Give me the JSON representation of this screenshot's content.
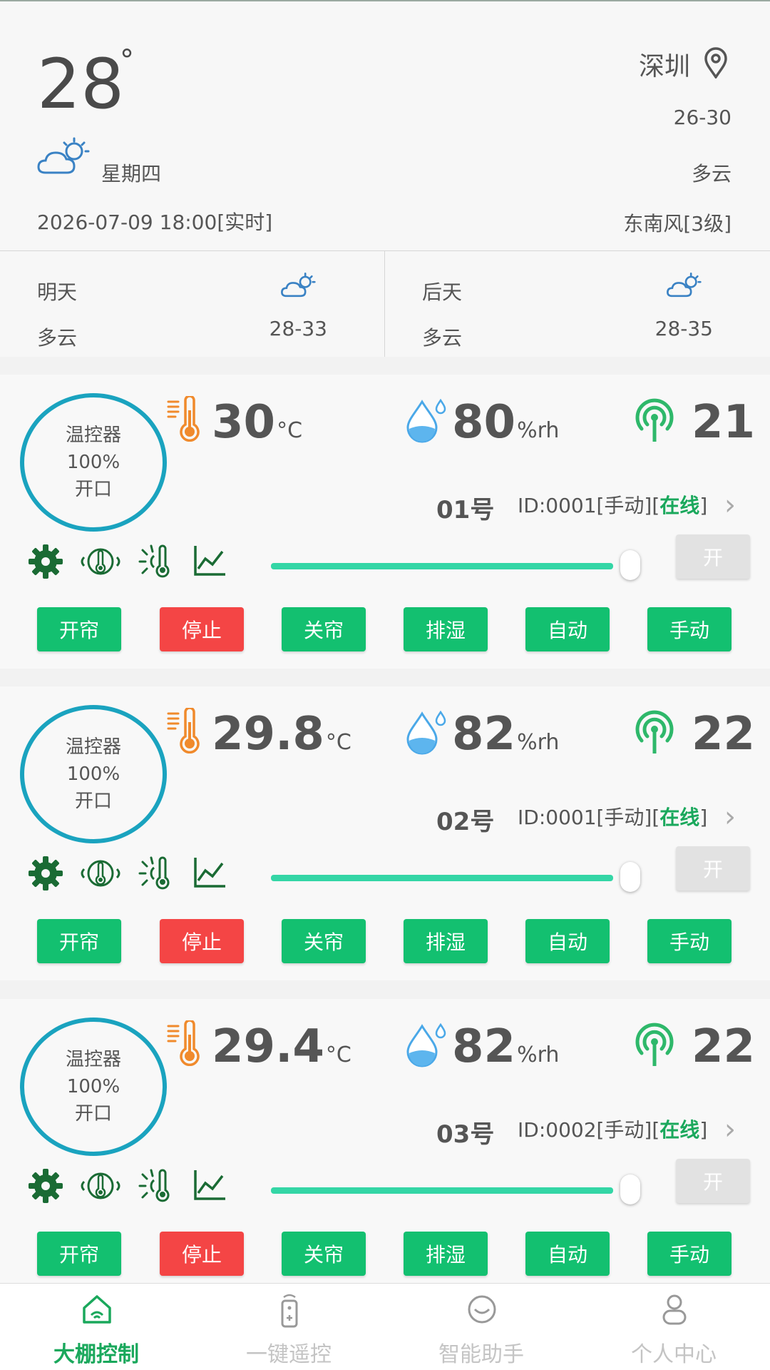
{
  "weather": {
    "temp": "28",
    "deg": "°",
    "weekday": "星期四",
    "datetime": "2026-07-09 18:00[实时]",
    "city": "深圳",
    "temp_range": "26-30",
    "condition": "多云",
    "wind": "东南风[3级]"
  },
  "forecast": [
    {
      "day": "明天",
      "condition": "多云",
      "range": "28-33"
    },
    {
      "day": "后天",
      "condition": "多云",
      "range": "28-35"
    }
  ],
  "devices": [
    {
      "ring": [
        "温控器",
        "100%",
        "开口"
      ],
      "temp": "30",
      "temp_unit": "°C",
      "hum": "80",
      "hum_unit": "%rh",
      "signal": "21",
      "number": "01号",
      "id_prefix": "ID:0001[手动][",
      "status": "在线",
      "id_suffix": "]",
      "switch_label": "开",
      "buttons": [
        "开帘",
        "停止",
        "关帘",
        "排湿",
        "自动",
        "手动"
      ]
    },
    {
      "ring": [
        "温控器",
        "100%",
        "开口"
      ],
      "temp": "29.8",
      "temp_unit": "°C",
      "hum": "82",
      "hum_unit": "%rh",
      "signal": "22",
      "number": "02号",
      "id_prefix": "ID:0001[手动][",
      "status": "在线",
      "id_suffix": "]",
      "switch_label": "开",
      "buttons": [
        "开帘",
        "停止",
        "关帘",
        "排湿",
        "自动",
        "手动"
      ]
    },
    {
      "ring": [
        "温控器",
        "100%",
        "开口"
      ],
      "temp": "29.4",
      "temp_unit": "°C",
      "hum": "82",
      "hum_unit": "%rh",
      "signal": "22",
      "number": "03号",
      "id_prefix": "ID:0002[手动][",
      "status": "在线",
      "id_suffix": "]",
      "switch_label": "开",
      "buttons": [
        "开帘",
        "停止",
        "关帘",
        "排湿",
        "自动",
        "手动"
      ]
    }
  ],
  "tabs": [
    {
      "label": "大棚控制",
      "icon": "greenhouse-icon",
      "active": true
    },
    {
      "label": "一键遥控",
      "icon": "remote-control-icon",
      "active": false
    },
    {
      "label": "智能助手",
      "icon": "assistant-chat-icon",
      "active": false
    },
    {
      "label": "个人中心",
      "icon": "person-icon",
      "active": false
    }
  ],
  "colors": {
    "accent_green": "#13c070",
    "stop_red": "#f44545",
    "ring_blue": "#1aa3bf",
    "slider": "#34d6a6"
  }
}
